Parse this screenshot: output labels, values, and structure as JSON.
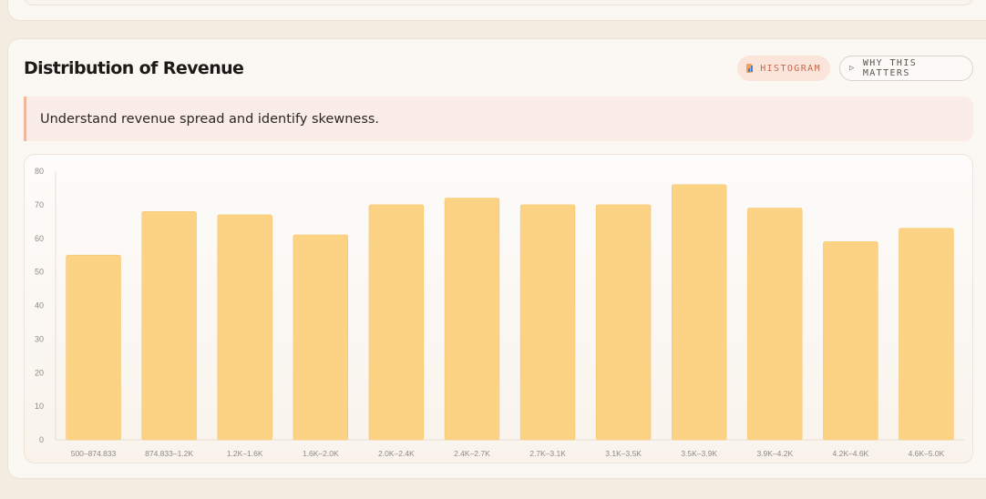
{
  "header": {
    "title": "Distribution of Revenue",
    "badge_histogram": "HISTOGRAM",
    "badge_why": "WHY THIS MATTERS"
  },
  "insight": {
    "text": "Understand revenue spread and identify skewness."
  },
  "icons": {
    "histogram": "bar-chart-icon",
    "why": "play-triangle-icon"
  },
  "colors": {
    "bar": "#fcd385",
    "accent": "#c46a4e",
    "insight_border": "#f2b89f"
  },
  "chart_data": {
    "type": "bar",
    "title": "Distribution of Revenue",
    "xlabel": "",
    "ylabel": "",
    "ylim": [
      0,
      80
    ],
    "yticks": [
      0,
      10,
      20,
      30,
      40,
      50,
      60,
      70,
      80
    ],
    "grid": false,
    "categories": [
      "500–874.833",
      "874.833–1.2K",
      "1.2K–1.6K",
      "1.6K–2.0K",
      "2.0K–2.4K",
      "2.4K–2.7K",
      "2.7K–3.1K",
      "3.1K–3.5K",
      "3.5K–3.9K",
      "3.9K–4.2K",
      "4.2K–4.6K",
      "4.6K–5.0K"
    ],
    "values": [
      55,
      68,
      67,
      61,
      70,
      72,
      70,
      70,
      76,
      69,
      59,
      63
    ]
  }
}
